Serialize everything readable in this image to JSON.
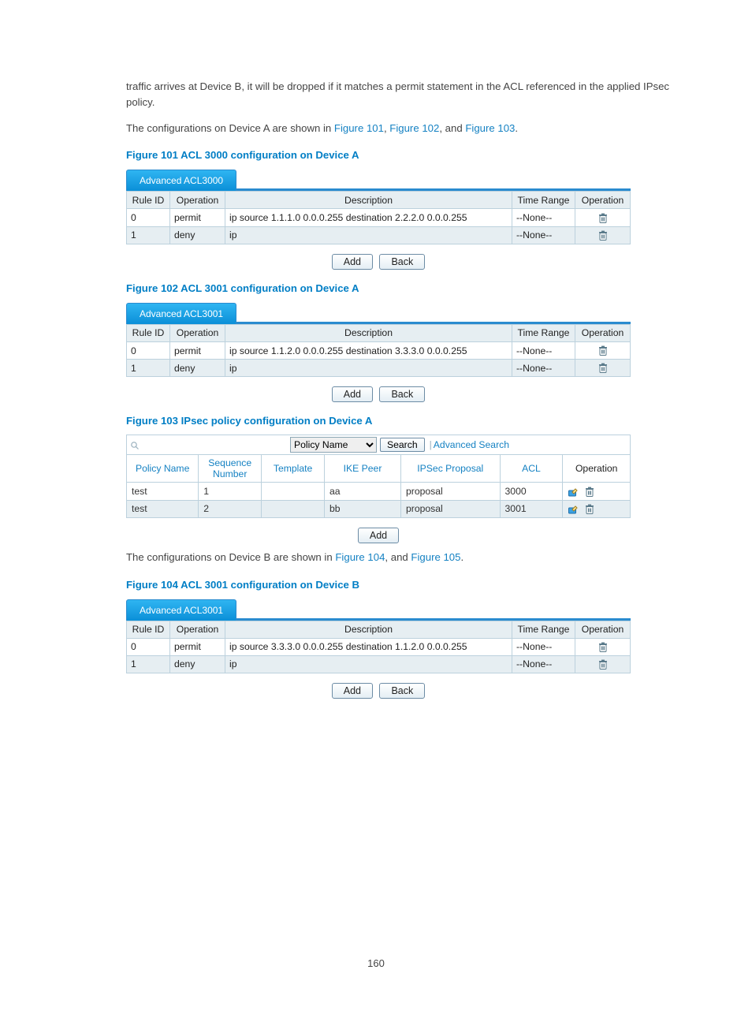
{
  "para1": "traffic arrives at Device B, it will be dropped if it matches a permit statement in the ACL referenced in the applied IPsec policy.",
  "para2_prefix": "The configurations on Device A are shown in ",
  "para2_l1": "Figure 101",
  "para2_l2": "Figure 102",
  "para2_l3": "Figure 103",
  "fig101_cap": "Figure 101 ACL 3000 configuration on Device A",
  "fig101_tab": "Advanced ACL3000",
  "acl_hdr": {
    "rule": "Rule ID",
    "op": "Operation",
    "desc": "Description",
    "tr": "Time Range",
    "op2": "Operation"
  },
  "fig101_rows": [
    {
      "rule": "0",
      "op": "permit",
      "desc": "ip source 1.1.1.0 0.0.0.255 destination 2.2.2.0 0.0.0.255",
      "tr": "--None--"
    },
    {
      "rule": "1",
      "op": "deny",
      "desc": "ip",
      "tr": "--None--"
    }
  ],
  "btn_add": "Add",
  "btn_back": "Back",
  "fig102_cap": "Figure 102 ACL 3001 configuration on Device A",
  "fig102_tab": "Advanced ACL3001",
  "fig102_rows": [
    {
      "rule": "0",
      "op": "permit",
      "desc": "ip source 1.1.2.0 0.0.0.255 destination 3.3.3.0 0.0.0.255",
      "tr": "--None--"
    },
    {
      "rule": "1",
      "op": "deny",
      "desc": "ip",
      "tr": "--None--"
    }
  ],
  "fig103_cap": "Figure 103 IPsec policy configuration on Device A",
  "search": {
    "dropdown": "Policy Name",
    "btn": "Search",
    "adv": "Advanced Search",
    "pipe": "|"
  },
  "ipsec_hdr": {
    "pn": "Policy Name",
    "seq": "Sequence Number",
    "tmpl": "Template",
    "ike": "IKE Peer",
    "prop": "IPSec Proposal",
    "acl": "ACL",
    "op": "Operation"
  },
  "ipsec_rows": [
    {
      "pn": "test",
      "seq": "1",
      "tmpl": "",
      "ike": "aa",
      "prop": "proposal",
      "acl": "3000"
    },
    {
      "pn": "test",
      "seq": "2",
      "tmpl": "",
      "ike": "bb",
      "prop": "proposal",
      "acl": "3001"
    }
  ],
  "para3_prefix": "The configurations on Device B are shown in ",
  "para3_l1": "Figure 104",
  "para3_l2": "Figure 105",
  "fig104_cap": "Figure 104 ACL 3001 configuration on Device B",
  "fig104_tab": "Advanced ACL3001",
  "fig104_rows": [
    {
      "rule": "0",
      "op": "permit",
      "desc": "ip source 3.3.3.0 0.0.0.255 destination 1.1.2.0 0.0.0.255",
      "tr": "--None--"
    },
    {
      "rule": "1",
      "op": "deny",
      "desc": "ip",
      "tr": "--None--"
    }
  ],
  "page_num": "160"
}
